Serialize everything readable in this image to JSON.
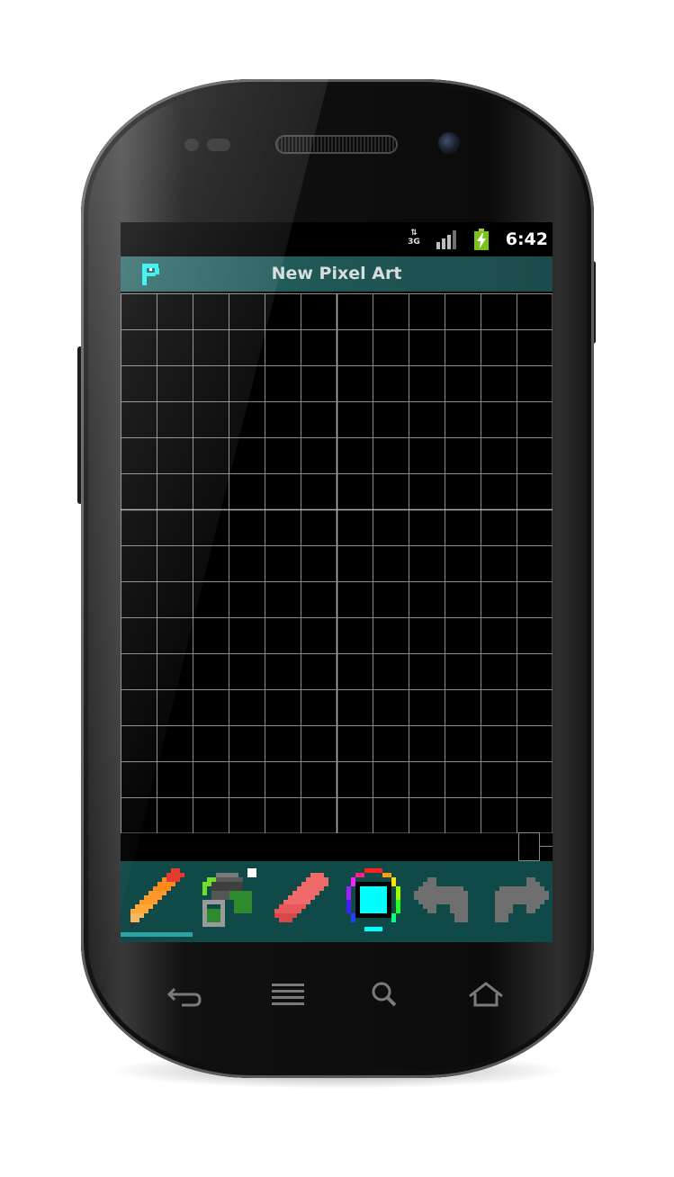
{
  "statusbar": {
    "network_label": "3G",
    "time": "6:42",
    "icons": [
      "data-transfer-icon",
      "signal-icon",
      "battery-charging-icon"
    ]
  },
  "titlebar": {
    "logo_icon": "pixel-p-logo-icon",
    "title": "New Pixel Art"
  },
  "canvas": {
    "columns": 12,
    "rows": 15,
    "grid_color": "#8c8c8c",
    "major_grid_color": "#b0b0b0",
    "background": "#000000"
  },
  "toolbar": {
    "background": "#0f4a48",
    "active_indicator_color": "#2aa5a0",
    "active_tool": "pencil",
    "tools": [
      {
        "name": "pencil",
        "icon": "pencil-icon"
      },
      {
        "name": "fill",
        "icon": "paint-bucket-icon"
      },
      {
        "name": "eraser",
        "icon": "eraser-icon"
      },
      {
        "name": "color",
        "icon": "color-picker-icon",
        "current_color": "#00ffff"
      },
      {
        "name": "undo",
        "icon": "undo-arrow-icon"
      },
      {
        "name": "redo",
        "icon": "redo-arrow-icon"
      }
    ]
  },
  "navbar": {
    "keys": [
      "back-icon",
      "menu-icon",
      "search-icon",
      "home-icon"
    ]
  }
}
